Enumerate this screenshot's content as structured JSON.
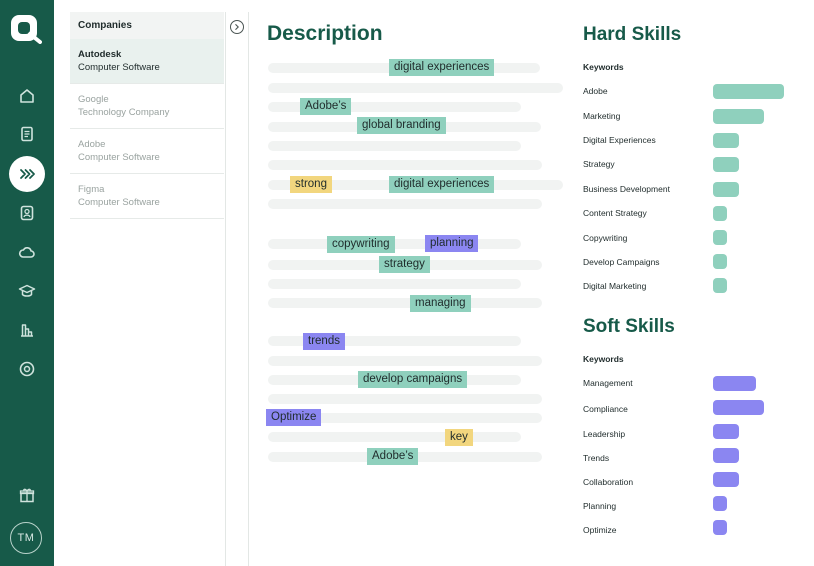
{
  "rail": {
    "items": [
      {
        "icon": "home-icon"
      },
      {
        "icon": "document-icon"
      },
      {
        "icon": "chevrons-right-icon",
        "active": true
      },
      {
        "icon": "profile-card-icon"
      },
      {
        "icon": "cloud-icon"
      },
      {
        "icon": "graduation-cap-icon"
      },
      {
        "icon": "bar-chart-icon"
      },
      {
        "icon": "target-icon"
      },
      {
        "icon": "gift-icon"
      }
    ],
    "avatar_initials": "TM"
  },
  "companies": {
    "header": "Companies",
    "items": [
      {
        "name": "Autodesk",
        "type": "Computer Software",
        "active": true
      },
      {
        "name": "Google",
        "type": "Technology Company"
      },
      {
        "name": "Adobe",
        "type": "Computer Software"
      },
      {
        "name": "Figma",
        "type": "Computer Software"
      }
    ]
  },
  "description": {
    "title": "Description",
    "keywords": [
      {
        "text": "digital experiences",
        "kind": "hard"
      },
      {
        "text": "Adobe’s",
        "kind": "hard"
      },
      {
        "text": "global branding",
        "kind": "hard"
      },
      {
        "text": "strong",
        "kind": "highlight"
      },
      {
        "text": "digital experiences",
        "kind": "hard"
      },
      {
        "text": "copywriting",
        "kind": "hard"
      },
      {
        "text": "planning",
        "kind": "soft"
      },
      {
        "text": "strategy",
        "kind": "hard"
      },
      {
        "text": "managing",
        "kind": "hard"
      },
      {
        "text": "trends",
        "kind": "soft"
      },
      {
        "text": "develop campaigns",
        "kind": "hard"
      },
      {
        "text": "Optimize",
        "kind": "soft"
      },
      {
        "text": "key",
        "kind": "highlight"
      },
      {
        "text": "Adobe’s",
        "kind": "hard"
      }
    ]
  },
  "hard_skills": {
    "title": "Hard Skills",
    "keywords_label": "Keywords",
    "items": [
      {
        "label": "Adobe",
        "level": 1.0
      },
      {
        "label": "Marketing",
        "level": 0.72
      },
      {
        "label": "Digital Experiences",
        "level": 0.37
      },
      {
        "label": "Strategy",
        "level": 0.37
      },
      {
        "label": "Business Development",
        "level": 0.37
      },
      {
        "label": "Content Strategy",
        "level": 0.2
      },
      {
        "label": "Copywriting",
        "level": 0.2
      },
      {
        "label": "Develop Campaigns",
        "level": 0.2
      },
      {
        "label": "Digital Marketing",
        "level": 0.2
      }
    ]
  },
  "soft_skills": {
    "title": "Soft Skills",
    "keywords_label": "Keywords",
    "items": [
      {
        "label": "Management",
        "level": 0.6
      },
      {
        "label": "Compliance",
        "level": 0.72
      },
      {
        "label": "Leadership",
        "level": 0.37
      },
      {
        "label": "Trends",
        "level": 0.37
      },
      {
        "label": "Collaboration",
        "level": 0.37
      },
      {
        "label": "Planning",
        "level": 0.2
      },
      {
        "label": "Optimize",
        "level": 0.2
      }
    ]
  },
  "colors": {
    "brand": "#175a49",
    "hard": "#8fd0bd",
    "soft": "#8b86f1",
    "highlight": "#f2d67e"
  }
}
